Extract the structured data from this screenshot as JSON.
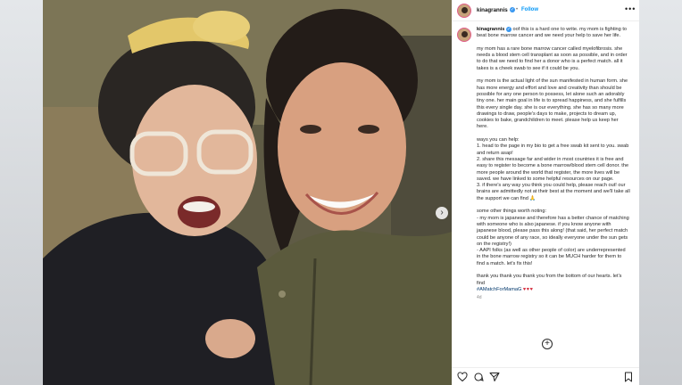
{
  "post": {
    "username": "kinagrannis",
    "follow_label": "Follow",
    "dot": "•",
    "more": "•••",
    "next_label": "›",
    "add_label": "+",
    "caption_lead": "oof this is a hard one to write. my mom is fighting to beat bone marrow cancer and we need your help to save her life.",
    "paragraphs": [
      "my mom has a rare bone marrow cancer called myelofibrosis. she needs a blood stem cell transplant as soon as possible, and in order to do that we need to find her a donor who is a perfect match. all it takes is a cheek swab to see if it could be you.",
      "my mom is the actual light of the sun manifested in human form. she has more energy and effort and love and creativity than should be possible for any one person to possess, let alone such an adorably tiny one. her main goal in life is to spread happiness, and she fulfills this every single day. she is our everything. she has so many more drawings to draw, people's days to make, projects to dream up, cookies to bake, grandchildren to meet. please help us keep her here.",
      "ways you can help:\n1. head to the page in my bio to get a free swab kit sent to you. swab and return asap!\n2. share this message far and wider in most countries it is free and easy to register to become a bone marrow/blood stem cell donor. the more people around the world that register, the more lives will be saved. we have linked to some helpful resources on our page.\n3. if there's any way you think you could help, please reach out! our brains are admittedly not at their best at the moment and we'll take all the support we can find 🙏",
      "some other things worth noting:\n- my mom is japanese and therefore has a better chance of matching with someone who is also japanese. if you know anyone with japanese blood, please pass this along! (that said, her perfect match could be anyone of any race, so ideally everyone under the sun gets on the registry!)\n- AAPI folks (as well as other people of color) are underrepresented in the bone marrow registry so it can be MUCH harder for them to find a match. let's fix this!",
      "thank you thank you thank you from the bottom of our hearts. let's find"
    ],
    "hashtag": "#AMatchForMamaG",
    "hearts": "♥♥♥",
    "time_ago": "4d"
  },
  "colors": {
    "link": "#0095f6",
    "verified": "#3897f0",
    "heart": "#d42a3b"
  },
  "icons": [
    "verified-badge-icon",
    "more-options-icon",
    "carousel-next-icon",
    "add-comment-icon",
    "heart-icon",
    "comment-icon",
    "share-icon",
    "save-icon"
  ]
}
